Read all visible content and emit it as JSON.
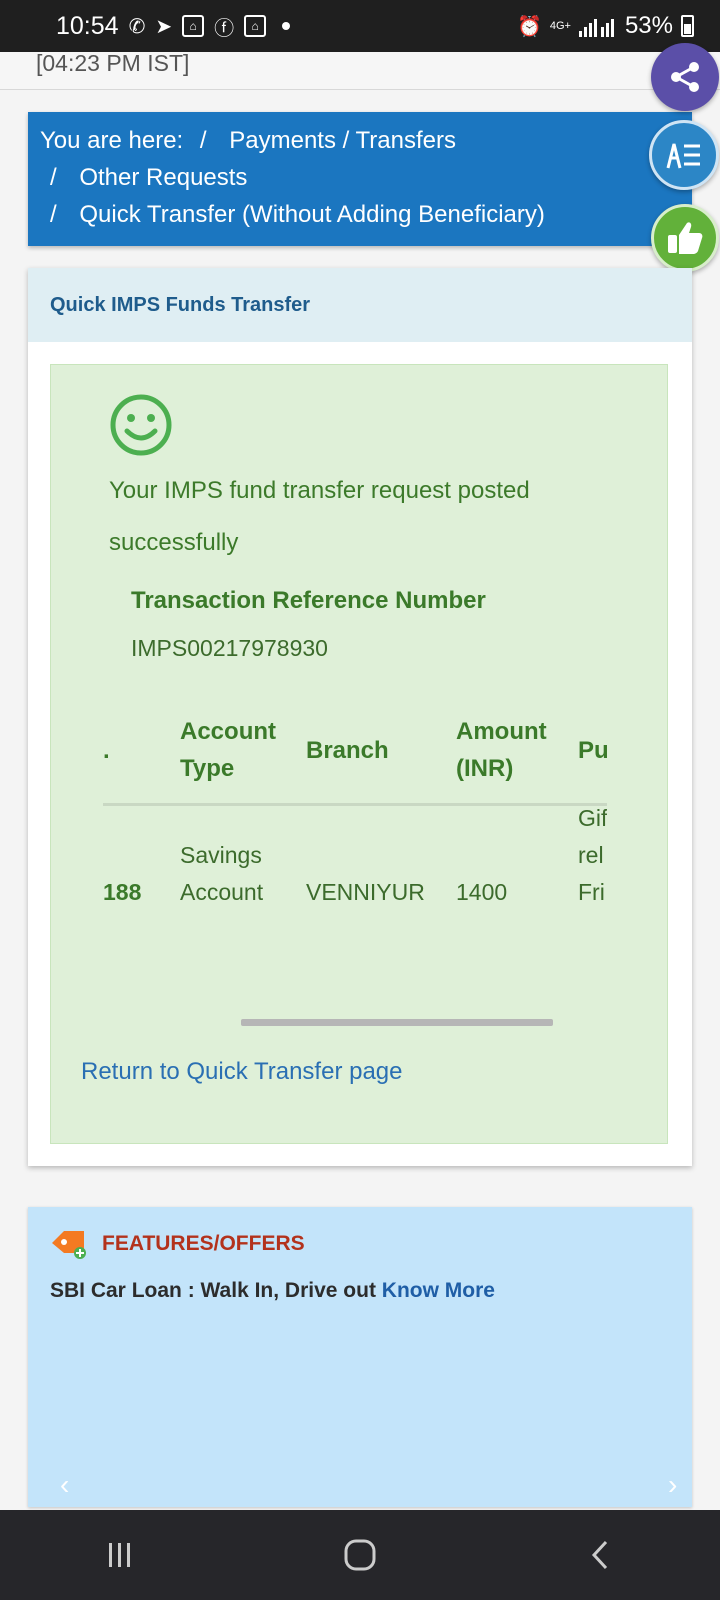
{
  "status_bar": {
    "time": "10:54",
    "network": "4G+",
    "battery": "53%"
  },
  "header": {
    "time_text": "[04:23 PM IST]"
  },
  "breadcrumb": {
    "prefix": "You are here:",
    "items": [
      "Payments / Transfers",
      "Other Requests",
      "Quick Transfer (Without Adding Beneficiary)"
    ]
  },
  "card": {
    "title": "Quick IMPS Funds Transfer",
    "success_message": "Your IMPS fund transfer request posted successfully",
    "ref_label": "Transaction Reference Number",
    "ref_value": "IMPS00217978930",
    "table": {
      "headers": [
        ".",
        "Account Type",
        "Branch",
        "Amount (INR)",
        "Pu"
      ],
      "row": {
        "account": "188",
        "account_type": "Savings Account",
        "branch": "VENNIYUR",
        "amount": "1400",
        "purpose": "Gif rel / Fri"
      }
    },
    "return_link": "Return to Quick Transfer page"
  },
  "features": {
    "title": "FEATURES/OFFERS",
    "offer_text": "SBI Car Loan : Walk In, Drive out",
    "offer_link": "Know More"
  },
  "colors": {
    "breadcrumb_bg": "#1b76c0",
    "success_bg": "#dff0d8",
    "success_text": "#3b7a2a",
    "features_bg": "#c3e4fa"
  },
  "icons": [
    "whatsapp-icon",
    "telegram-icon",
    "facebook-icon",
    "alarm-icon",
    "share-icon",
    "report-icon",
    "thumbs-up-icon",
    "smiley-icon",
    "tag-icon"
  ]
}
